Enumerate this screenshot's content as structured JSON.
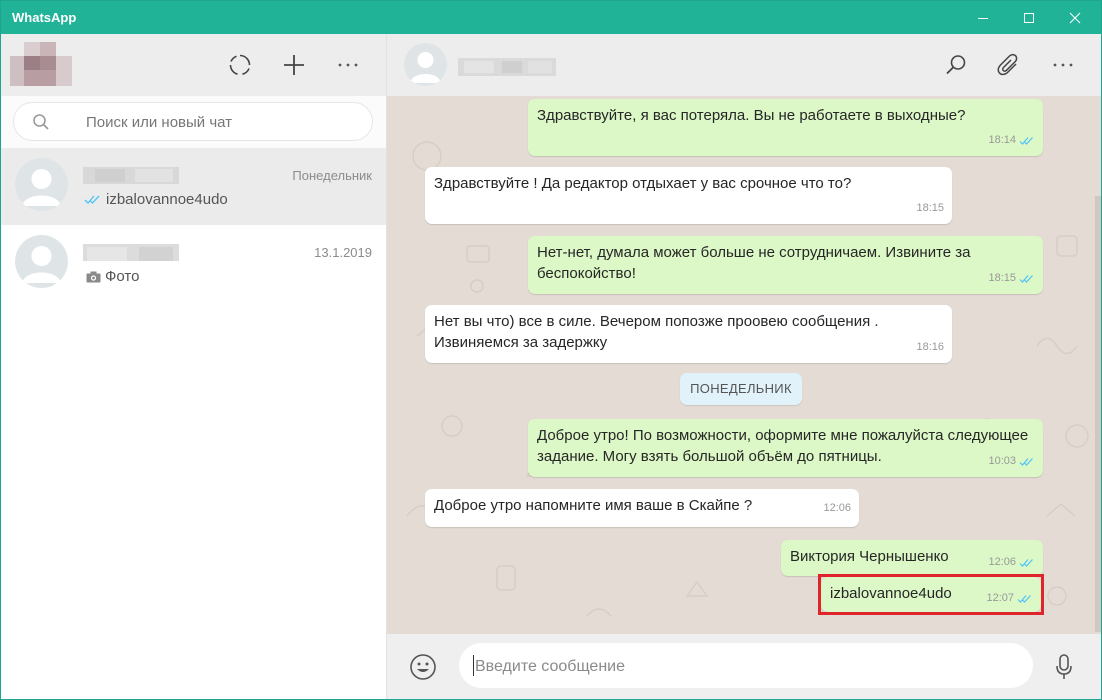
{
  "window": {
    "title": "WhatsApp"
  },
  "colors": {
    "titlebar": "#20b398",
    "outgoing_bubble": "#dcf8c6",
    "incoming_bubble": "#ffffff",
    "check_read": "#4fc3f7",
    "highlight_box": "#e0242b"
  },
  "sidebar": {
    "header_icons": [
      "status-icon",
      "new-chat-icon",
      "menu-icon"
    ],
    "search": {
      "placeholder": "Поиск или новый чат",
      "value": ""
    },
    "chats": [
      {
        "name": "",
        "date": "Понедельник",
        "preview": "izbalovannoe4udo",
        "preview_icon": "double-check-icon",
        "active": true
      },
      {
        "name": "",
        "date": "13.1.2019",
        "preview": "Фото",
        "preview_icon": "camera-icon",
        "active": false
      }
    ]
  },
  "conversation": {
    "header_icons": [
      "search-icon",
      "attach-icon",
      "menu-icon"
    ],
    "day_separator": "ПОНЕДЕЛЬНИК",
    "messages": [
      {
        "direction": "out",
        "lines": [
          "Здравствуйте, я вас потеряла. Вы не работаете в выходные?"
        ],
        "time": "18:14",
        "read": true
      },
      {
        "direction": "in",
        "lines": [
          "Здравствуйте ! Да редактор отдыхает у вас срочное что то?"
        ],
        "time": "18:15"
      },
      {
        "direction": "out",
        "lines": [
          "Нет-нет, думала может больше не сотрудничаем. Извините за",
          "беспокойство!"
        ],
        "time": "18:15",
        "read": true
      },
      {
        "direction": "in",
        "lines": [
          "Нет вы что) все в силе. Вечером попозже проовею сообщения .",
          "Извиняемся за задержку"
        ],
        "time": "18:16"
      },
      {
        "direction": "out",
        "lines": [
          "Доброе утро! По возможности, оформите мне пожалуйста следующее",
          "задание. Могу взять большой объём до пятницы."
        ],
        "time": "10:03",
        "read": true
      },
      {
        "direction": "in",
        "lines": [
          "Доброе утро напомните имя ваше в Скайпе ?"
        ],
        "time": "12:06"
      },
      {
        "direction": "out",
        "lines": [
          "Виктория Чернышенко"
        ],
        "time": "12:06",
        "read": true
      },
      {
        "direction": "out",
        "lines": [
          "izbalovannoe4udo"
        ],
        "time": "12:07",
        "read": true,
        "highlighted": true
      }
    ]
  },
  "composer": {
    "placeholder": "Введите сообщение",
    "value": "",
    "icons": [
      "emoji-icon",
      "microphone-icon"
    ]
  }
}
